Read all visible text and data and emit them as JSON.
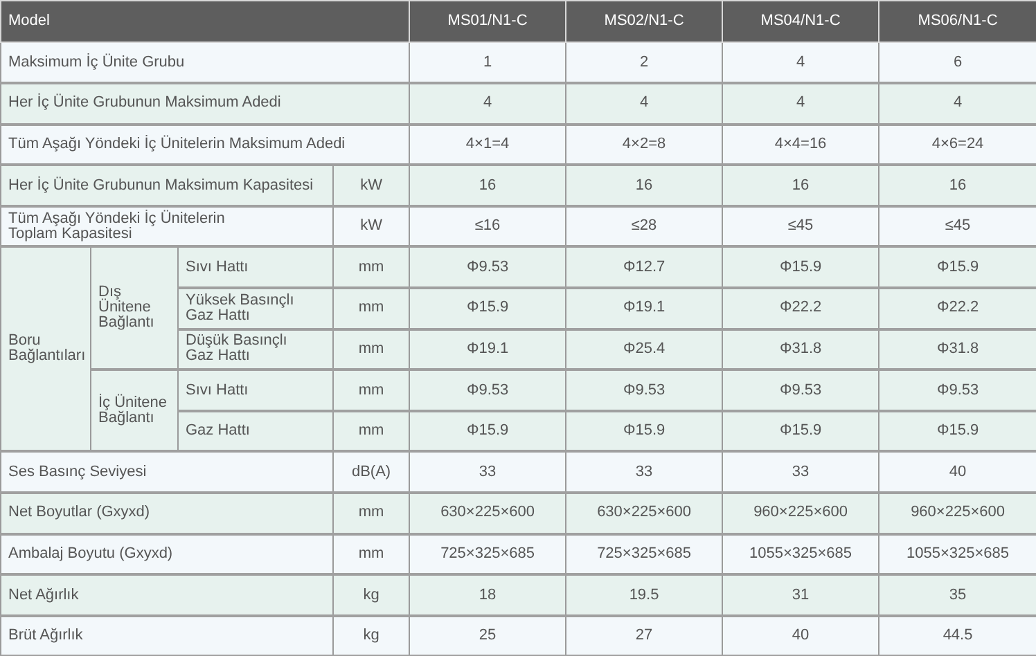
{
  "header": {
    "label": "Model",
    "models": [
      "MS01/N1-C",
      "MS02/N1-C",
      "MS04/N1-C",
      "MS06/N1-C"
    ]
  },
  "rows": [
    {
      "kind": "plain",
      "label": "Maksimum İç Ünite Grubu",
      "values": [
        "1",
        "2",
        "4",
        "6"
      ]
    },
    {
      "kind": "plain",
      "label": "Her İç Ünite Grubunun Maksimum Adedi",
      "values": [
        "4",
        "4",
        "4",
        "4"
      ]
    },
    {
      "kind": "plain",
      "label": "Tüm Aşağı Yöndeki İç Ünitelerin Maksimum Adedi",
      "values": [
        "4×1=4",
        "4×2=8",
        "4×4=16",
        "4×6=24"
      ]
    },
    {
      "kind": "unit",
      "label": "Her İç Ünite Grubunun Maksimum Kapasitesi",
      "unit": "kW",
      "values": [
        "16",
        "16",
        "16",
        "16"
      ]
    },
    {
      "kind": "unit",
      "label": "Tüm Aşağı Yöndeki İç Ünitelerin\nToplam Kapasitesi",
      "unit": "kW",
      "values": [
        "≤16",
        "≤28",
        "≤45",
        "≤45"
      ]
    },
    {
      "kind": "group",
      "label": "Boru\nBağlantıları",
      "subgroups": [
        {
          "label": "Dış Ünitene\nBağlantı",
          "lines": [
            {
              "label": "Sıvı Hattı",
              "unit": "mm",
              "values": [
                "Φ9.53",
                "Φ12.7",
                "Φ15.9",
                "Φ15.9"
              ]
            },
            {
              "label": "Yüksek Basınçlı\nGaz Hattı",
              "unit": "mm",
              "values": [
                "Φ15.9",
                "Φ19.1",
                "Φ22.2",
                "Φ22.2"
              ]
            },
            {
              "label": "Düşük Basınçlı\nGaz Hattı",
              "unit": "mm",
              "values": [
                "Φ19.1",
                "Φ25.4",
                "Φ31.8",
                "Φ31.8"
              ]
            }
          ]
        },
        {
          "label": "İç Ünitene\nBağlantı",
          "lines": [
            {
              "label": "Sıvı Hattı",
              "unit": "mm",
              "values": [
                "Φ9.53",
                "Φ9.53",
                "Φ9.53",
                "Φ9.53"
              ]
            },
            {
              "label": "Gaz Hattı",
              "unit": "mm",
              "values": [
                "Φ15.9",
                "Φ15.9",
                "Φ15.9",
                "Φ15.9"
              ]
            }
          ]
        }
      ]
    },
    {
      "kind": "unit",
      "label": "Ses Basınç Seviyesi",
      "unit": "dB(A)",
      "values": [
        "33",
        "33",
        "33",
        "40"
      ]
    },
    {
      "kind": "unit",
      "label": "Net Boyutlar (Gxyxd)",
      "unit": "mm",
      "values": [
        "630×225×600",
        "630×225×600",
        "960×225×600",
        "960×225×600"
      ]
    },
    {
      "kind": "unit",
      "label": "Ambalaj Boyutu (Gxyxd)",
      "unit": "mm",
      "values": [
        "725×325×685",
        "725×325×685",
        "1055×325×685",
        "1055×325×685"
      ]
    },
    {
      "kind": "unit",
      "label": "Net Ağırlık",
      "unit": "kg",
      "values": [
        "18",
        "19.5",
        "31",
        "35"
      ]
    },
    {
      "kind": "unit",
      "label": "Brüt Ağırlık",
      "unit": "kg",
      "values": [
        "25",
        "27",
        "40",
        "44.5"
      ]
    }
  ]
}
